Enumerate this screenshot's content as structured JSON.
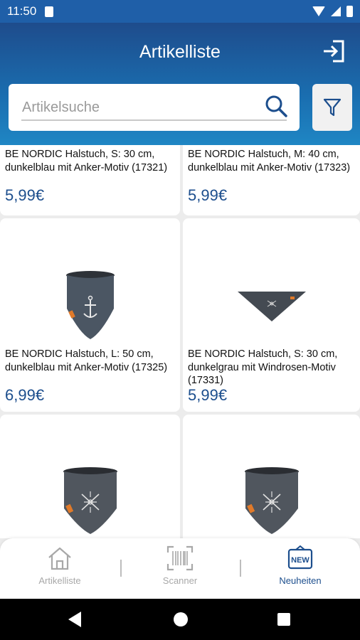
{
  "status_bar": {
    "time": "11:50"
  },
  "header": {
    "title": "Artikelliste"
  },
  "search": {
    "placeholder": "Artikelsuche"
  },
  "products": [
    {
      "name": "BE NORDIC Halstuch, S: 30 cm, dunkelblau mit Anker-Motiv (17321)",
      "price": "5,99€"
    },
    {
      "name": "BE NORDIC Halstuch, M: 40 cm, dunkelblau mit Anker-Motiv (17323)",
      "price": "5,99€"
    },
    {
      "name": "BE NORDIC Halstuch, L: 50 cm, dunkelblau mit Anker-Motiv (17325)",
      "price": "6,99€"
    },
    {
      "name": "BE NORDIC Halstuch, S: 30 cm, dunkelgrau mit Windrosen-Motiv (17331)",
      "price": "5,99€"
    }
  ],
  "bottom_nav": {
    "items": [
      {
        "label": "Artikelliste"
      },
      {
        "label": "Scanner"
      },
      {
        "label": "Neuheiten",
        "badge": "NEW"
      }
    ]
  },
  "colors": {
    "header": "#1a6eb0",
    "accent": "#1c4e8d",
    "inactive": "#a8a8a8"
  }
}
